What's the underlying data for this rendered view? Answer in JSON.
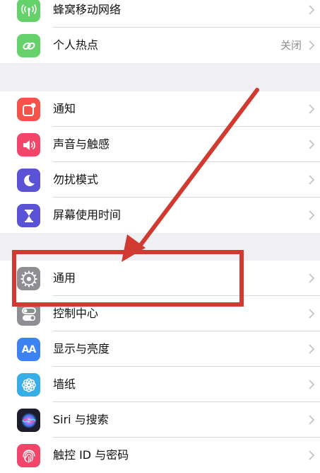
{
  "groups": [
    {
      "items": [
        {
          "label": "蜂窝移动网络",
          "icon": "antenna-icon",
          "color": "#65d16b"
        },
        {
          "label": "个人热点",
          "value": "关闭",
          "icon": "chain-link-icon",
          "color": "#65d16b"
        }
      ]
    },
    {
      "items": [
        {
          "label": "通知",
          "icon": "notification-icon",
          "color": "#f2544c"
        },
        {
          "label": "声音与触感",
          "icon": "speaker-icon",
          "color": "#f2456a"
        },
        {
          "label": "勿扰模式",
          "icon": "moon-icon",
          "color": "#5b53d6"
        },
        {
          "label": "屏幕使用时间",
          "icon": "hourglass-icon",
          "color": "#5b53d6"
        }
      ]
    },
    {
      "items": [
        {
          "label": "通用",
          "icon": "gear-icon",
          "color": "#8e8e93"
        },
        {
          "label": "控制中心",
          "icon": "toggles-icon",
          "color": "#8e8e93"
        },
        {
          "label": "显示与亮度",
          "icon": "aa-icon",
          "color": "#3c82f0"
        },
        {
          "label": "墙纸",
          "icon": "flower-icon",
          "color": "#38aee6"
        },
        {
          "label": "Siri 与搜索",
          "icon": "siri-icon",
          "color": "#1d1d2e"
        },
        {
          "label": "触控 ID 与密码",
          "icon": "fingerprint-icon",
          "color": "#f2456a"
        }
      ]
    }
  ],
  "icon_glyphs": {
    "aa": "AA"
  },
  "annotation": {
    "arrow_color": "#d03a31",
    "box_color": "#d03a31"
  }
}
